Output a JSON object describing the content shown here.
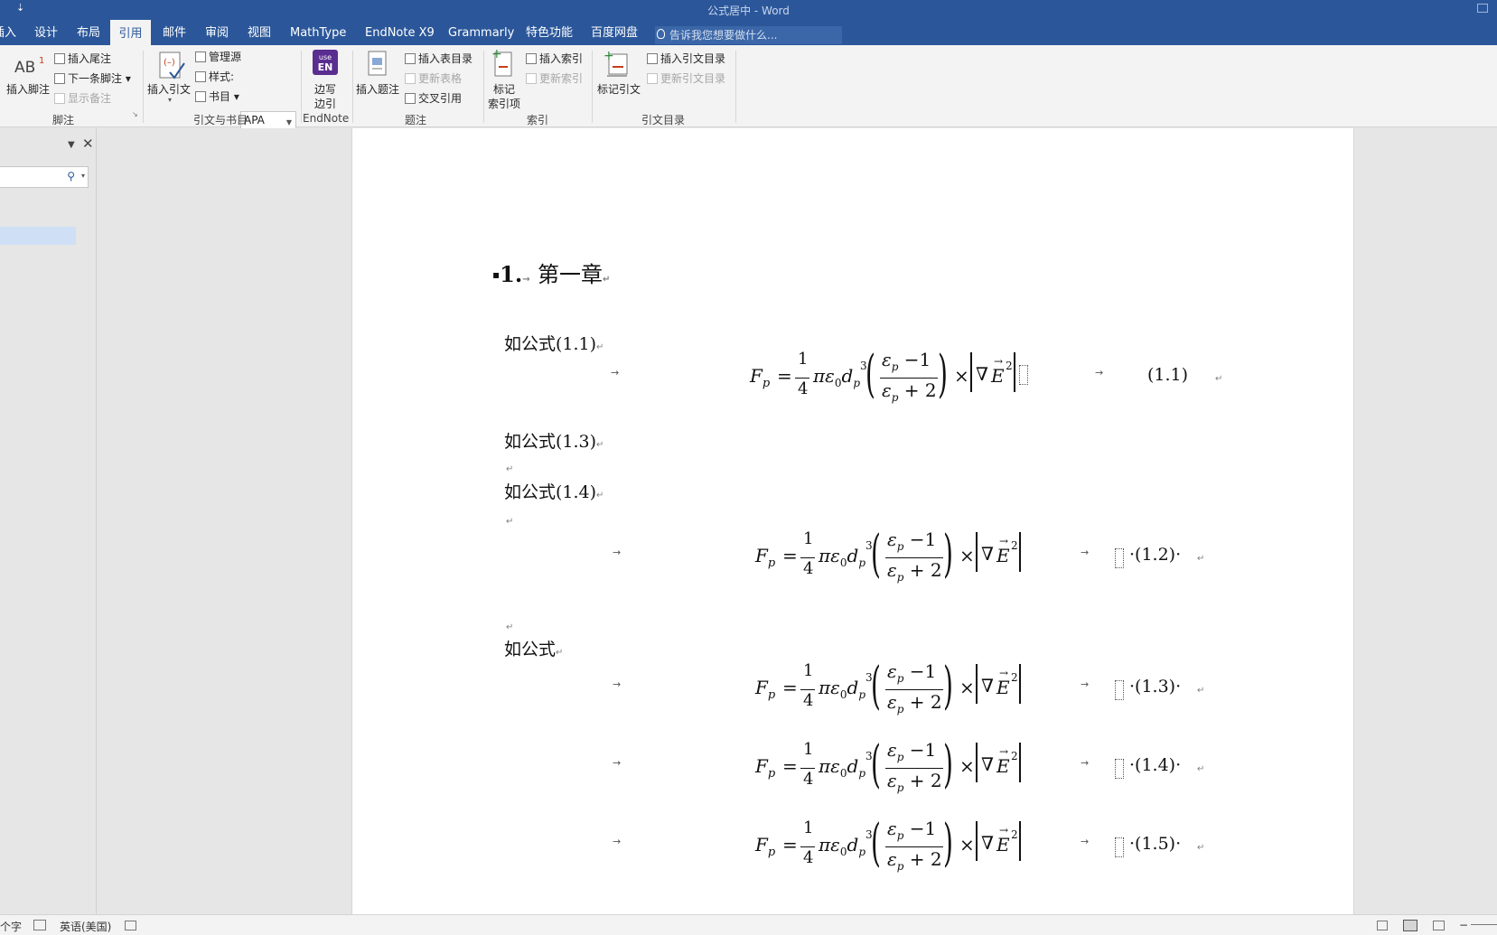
{
  "window": {
    "title": "公式居中 - Word",
    "qat": "⇣"
  },
  "tabs": [
    {
      "label": "插入",
      "display": "插入"
    },
    {
      "label": "设计"
    },
    {
      "label": "布局"
    },
    {
      "label": "引用",
      "active": true
    },
    {
      "label": "邮件"
    },
    {
      "label": "审阅"
    },
    {
      "label": "视图"
    },
    {
      "label": "MathType"
    },
    {
      "label": "EndNote X9"
    },
    {
      "label": "Grammarly"
    },
    {
      "label": "特色功能"
    },
    {
      "label": "百度网盘"
    }
  ],
  "tellme": {
    "placeholder": "告诉我您想要做什么..."
  },
  "ribbon": {
    "footnotes": {
      "insert_footnote": "插入脚注",
      "insert_endnote": "插入尾注",
      "next_footnote": "下一条脚注",
      "show_notes": "显示备注",
      "group": "脚注",
      "ab_glyph": "AB",
      "ab_sup": "1"
    },
    "citations": {
      "insert_citation": "插入引文",
      "manage_sources": "管理源",
      "style_label": "样式:",
      "style_value": "APA",
      "bibliography": "书目",
      "group": "引文与书目"
    },
    "endnote": {
      "label1": "边写",
      "label2": "边引",
      "icon_top": "use",
      "icon_bottom": "EN",
      "group": "EndNote"
    },
    "captions": {
      "insert_caption": "插入题注",
      "insert_table_of_figures": "插入表目录",
      "update_table": "更新表格",
      "cross_reference": "交叉引用",
      "group": "题注"
    },
    "index": {
      "mark_entry1": "标记",
      "mark_entry2": "索引项",
      "insert_index": "插入索引",
      "update_index": "更新索引",
      "group": "索引"
    },
    "toa": {
      "mark_citation": "标记引文",
      "insert_toa": "插入引文目录",
      "update_toa": "更新引文目录",
      "group": "引文目录"
    }
  },
  "document": {
    "heading": {
      "bullet": "▪",
      "number": "1.",
      "arrow": "→",
      "text": "第一章",
      "mark": "↵"
    },
    "paragraphs": [
      {
        "text": "如公式(1.1)",
        "mark": "↵"
      },
      {
        "text": "如公式(1.3)",
        "mark": "↵"
      },
      {
        "text": "如公式(1.4)",
        "mark": "↵"
      },
      {
        "text": "如公式",
        "mark": "↵"
      }
    ],
    "empty_mark": "↵",
    "tab_arrow": "→",
    "equation": {
      "F": "F",
      "sub_p": "p",
      "eq": "=",
      "one": "1",
      "four": "4",
      "pi_eps": "πε",
      "zero": "0",
      "d": "d",
      "three": "3",
      "eps": "ε",
      "minus1": "−1",
      "plus2": "+ 2",
      "times": "×",
      "nabla": "∇",
      "E": "E",
      "two": "2"
    },
    "equation_numbers": [
      "(1.1)",
      "·(1.2)·",
      "·(1.3)·",
      "·(1.4)·",
      "·(1.5)·"
    ]
  },
  "status": {
    "words": "个字",
    "language": "英语(美国)",
    "zoom_minus": "−"
  },
  "colors": {
    "accent": "#2b579a",
    "ribbon": "#f3f3f3",
    "page": "#ffffff",
    "canvas": "#e6e6e6"
  }
}
